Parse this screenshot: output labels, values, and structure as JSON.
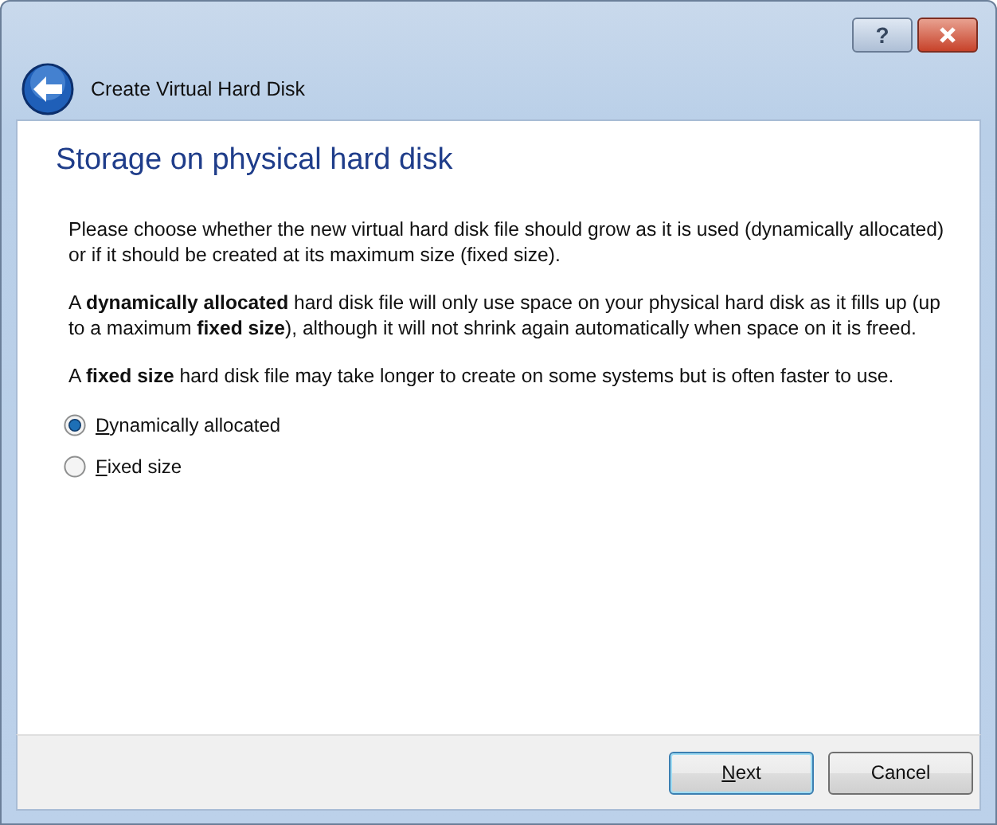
{
  "window": {
    "buttons": [
      {
        "kind": "help",
        "label": "?"
      },
      {
        "kind": "close"
      }
    ]
  },
  "header": {
    "title": "Create Virtual Hard Disk"
  },
  "page": {
    "heading": "Storage on physical hard disk",
    "paragraphs": [
      "Please choose whether the new virtual hard disk file should grow as it is used (dynamically allocated) or if it should be created at its maximum size (fixed size).",
      "A **dynamically allocated** hard disk file will only use space on your physical hard disk as it fills up (up to a maximum **fixed size**), although it will not shrink again automatically when space on it is freed.",
      "A **fixed size** hard disk file may take longer to create on some systems but is often faster to use."
    ],
    "options": [
      {
        "label": "Dynamically allocated",
        "selected": true
      },
      {
        "label": "Fixed size",
        "selected": false
      }
    ]
  },
  "buttons": [
    {
      "label": "Next",
      "default": true
    },
    {
      "label": "Cancel",
      "default": false
    }
  ]
}
